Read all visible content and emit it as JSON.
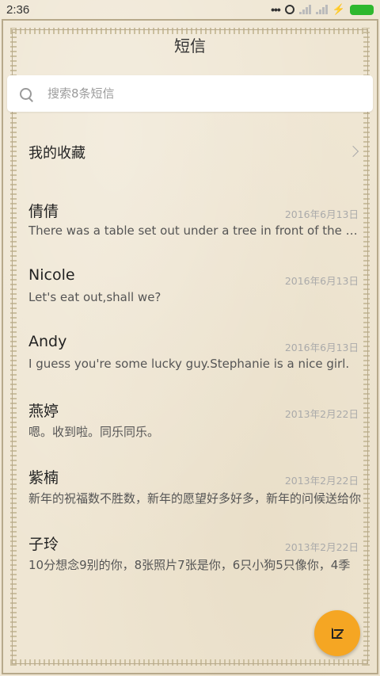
{
  "status_bar": {
    "time": "2:36"
  },
  "header": {
    "title": "短信"
  },
  "search": {
    "placeholder": "搜索8条短信",
    "value": ""
  },
  "favorites": {
    "label": "我的收藏"
  },
  "messages": [
    {
      "name": "倩倩",
      "date": "2016年6月13日",
      "preview": "There was a table set out under a tree in front of the house"
    },
    {
      "name": "Nicole",
      "date": "2016年6月13日",
      "preview": "Let's eat out,shall we?"
    },
    {
      "name": "Andy",
      "date": "2016年6月13日",
      "preview": "I guess you're some lucky guy.Stephanie is a nice girl."
    },
    {
      "name": "燕婷",
      "date": "2013年2月22日",
      "preview": "嗯。收到啦。同乐同乐。"
    },
    {
      "name": "紫楠",
      "date": "2013年2月22日",
      "preview": "新年的祝福数不胜数，新年的愿望好多好多，新年的问候送给你"
    },
    {
      "name": "子玲",
      "date": "2013年2月22日",
      "preview": "10分想念9别的你，8张照片7张是你，6只小狗5只像你，4季"
    }
  ],
  "colors": {
    "fab": "#f5a623",
    "battery": "#2eb82e"
  },
  "icons": {
    "search": "search-icon",
    "chevron": "chevron-right-icon",
    "compose": "compose-icon"
  }
}
